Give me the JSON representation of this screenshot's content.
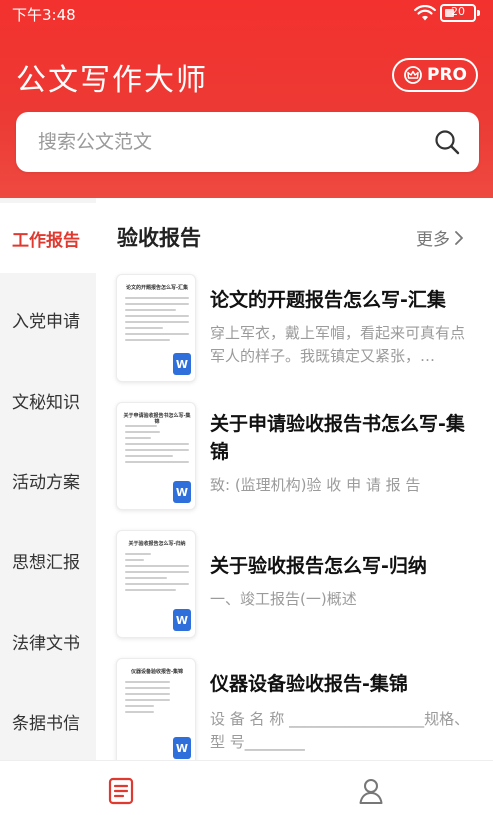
{
  "status_bar": {
    "time": "下午3:48",
    "battery": "20"
  },
  "header": {
    "title": "公文写作大师",
    "pro_label": "PRO"
  },
  "search": {
    "placeholder": "搜索公文范文"
  },
  "sidebar": {
    "items": [
      {
        "label": "工作报告",
        "active": true
      },
      {
        "label": "入党申请"
      },
      {
        "label": "文秘知识"
      },
      {
        "label": "活动方案"
      },
      {
        "label": "思想汇报"
      },
      {
        "label": "法律文书"
      },
      {
        "label": "条据书信"
      }
    ]
  },
  "main": {
    "section_title": "验收报告",
    "more_label": "更多",
    "articles": [
      {
        "title": "论文的开题报告怎么写-汇集",
        "excerpt": "穿上军衣，戴上军帽，看起来可真有点军人的样子。我既镇定又紧张，…",
        "thumb_title": "论文的开题报告怎么写-汇集"
      },
      {
        "title": "关于申请验收报告书怎么写-集锦",
        "excerpt": "致: (监理机构)验 收 申 请 报 告",
        "thumb_title": "关于申请验收报告书怎么写-集锦"
      },
      {
        "title": "关于验收报告怎么写-归纳",
        "excerpt": "一、竣工报告(一)概述",
        "thumb_title": "关于验收报告怎么写-归纳"
      },
      {
        "title": "仪器设备验收报告-集锦",
        "excerpt": "设 备 名 称 __________________规格、型 号________",
        "thumb_title": "仪器设备验收报告-集锦"
      }
    ]
  },
  "colors": {
    "brand": "#ee3a33",
    "active_text": "#e03a30"
  },
  "icons": {
    "thumb_badge": "W"
  }
}
